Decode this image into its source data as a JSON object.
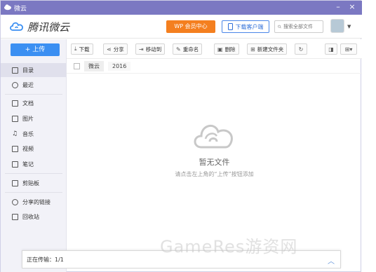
{
  "titlebar": {
    "title": "微云",
    "minimize": "–",
    "close": "×"
  },
  "header": {
    "logo_text": "腾讯微云",
    "vip_button": "WP 会员中心",
    "client_button": "下载客户端",
    "search_placeholder": "搜索全部文件"
  },
  "sidebar": {
    "upload_button": "+ 上传",
    "items": [
      {
        "label": "目录",
        "icon": "directory-icon"
      },
      {
        "label": "最近",
        "icon": "clock-icon"
      },
      {
        "label": "文档",
        "icon": "document-icon"
      },
      {
        "label": "图片",
        "icon": "image-icon"
      },
      {
        "label": "音乐",
        "icon": "music-icon"
      },
      {
        "label": "视频",
        "icon": "video-icon"
      },
      {
        "label": "笔记",
        "icon": "note-icon"
      },
      {
        "label": "剪贴板",
        "icon": "clipboard-icon"
      },
      {
        "label": "分享的链接",
        "icon": "link-icon"
      },
      {
        "label": "回收站",
        "icon": "trash-icon"
      }
    ]
  },
  "toolbar": {
    "download": "下载",
    "share": "分享",
    "move_to": "移动到",
    "rename": "重命名",
    "delete": "删除",
    "new_folder": "新建文件夹"
  },
  "breadcrumb": {
    "root": "微云",
    "current": "2016"
  },
  "empty_state": {
    "title": "暂无文件",
    "hint": "请点击左上角的“上传”按钮添加"
  },
  "statusbar": {
    "text": "正在传输：1/1"
  },
  "watermark": "GameRes游资网",
  "colors": {
    "titlebar": "#7b78c2",
    "accent": "#3b8ff2",
    "vip": "#f47f1f"
  }
}
